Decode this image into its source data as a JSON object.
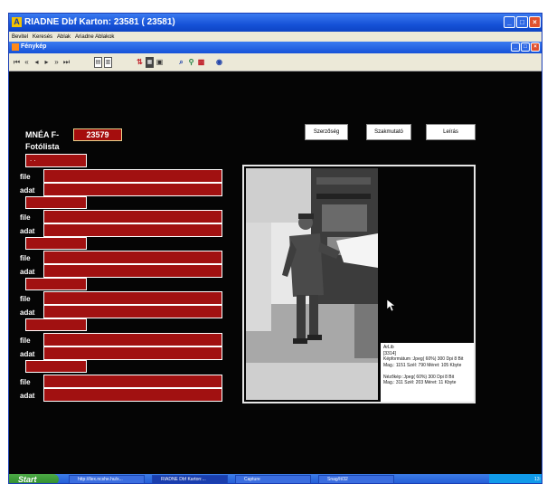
{
  "window": {
    "title": "RIADNE Dbf Karton:  23581  ( 23581)",
    "app_icon": "A"
  },
  "menu": [
    "Bevitel",
    "Keresés",
    "Ablak",
    "Ariadne Ablakok"
  ],
  "child_window": {
    "title": "Fénykép"
  },
  "toolbar": {
    "nav_icons": [
      "first-icon",
      "prev-page-icon",
      "prev-icon",
      "next-icon",
      "next-page-icon",
      "last-icon"
    ],
    "doc_icons": [
      "document-icon",
      "copy-document-icon"
    ],
    "tool_icons": [
      "sort-icon",
      "grid-icon",
      "print-icon",
      "search-icon",
      "filter-icon",
      "export-icon",
      "settings-icon"
    ],
    "colors": {
      "red": "#c0202a",
      "blue": "#2244aa",
      "green": "#208040"
    }
  },
  "form": {
    "mnea_label": "MNÉA F-",
    "mnea_value": "23579",
    "fotolista_label": "Fotólista",
    "fotolista_value": " . .",
    "file_label": "file",
    "adat_label": "adat"
  },
  "buttons": {
    "szerzoseg": "Szerzőség",
    "szakmutato": "Szakmutató",
    "leiras": "Leírás"
  },
  "info": {
    "line1": "ArLib",
    "line2": "[3314]",
    "line3": "Képformátum :Jpeg( 60%)  300 Dpi    8 Bit",
    "line4": "Mag.: 1151  Szél: 790  Méret:  105 Kbyte",
    "line5": "",
    "line6": "Nézőkép :Jpeg( 60%)  300 Dpi    8 Bit",
    "line7": "Mag.: 311  Szél: 203  Méret:   11 Kbyte"
  },
  "taskbar": {
    "start": "Start",
    "tasks": [
      "http://ilex.ncshe.hu/x...",
      "RIADNE Dbf Karton:...",
      "Capture",
      "Snag/It/32"
    ],
    "tray_time": "13:"
  },
  "colors": {
    "background": "#050505",
    "field_red": "#a11111",
    "titlebar_blue": "#1652d8"
  }
}
